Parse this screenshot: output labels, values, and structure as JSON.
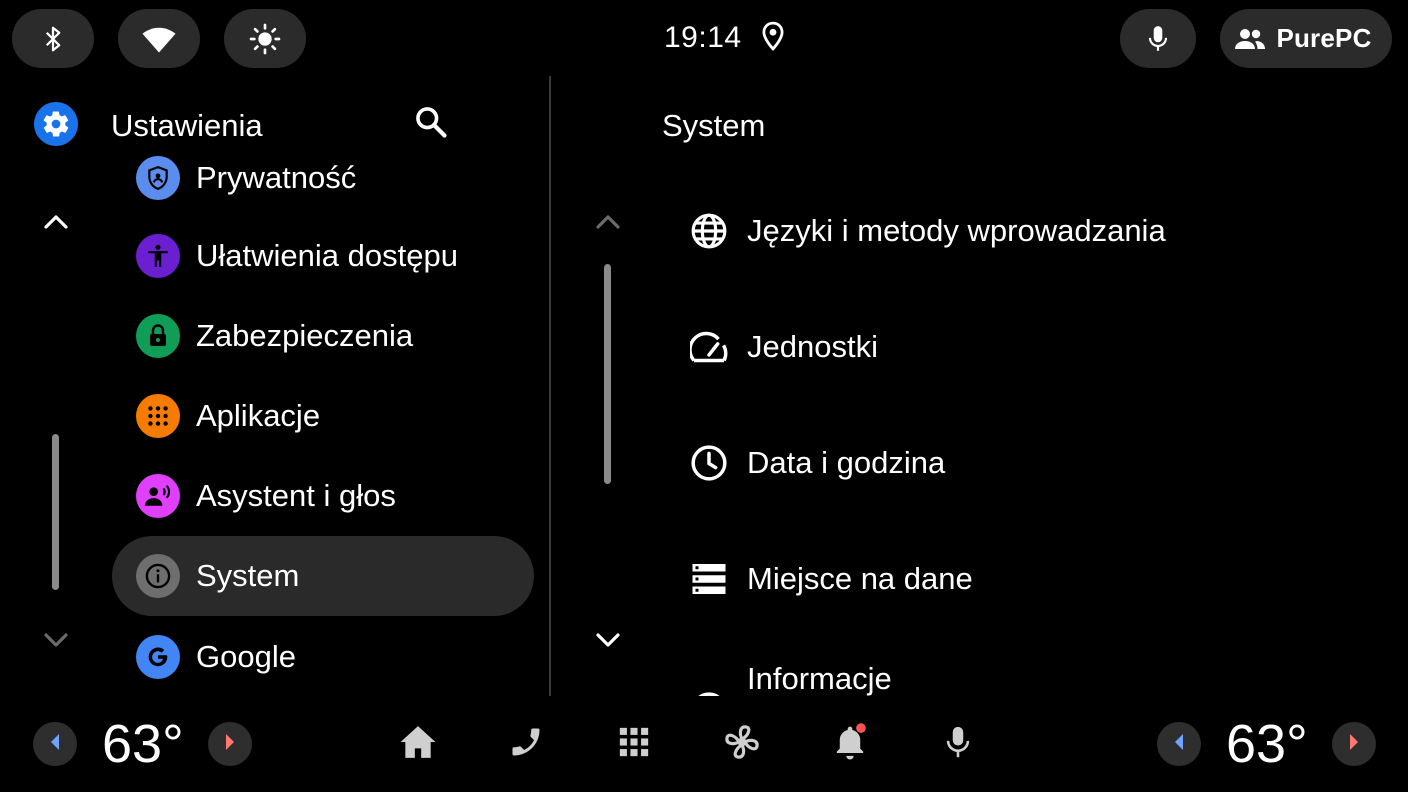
{
  "status_bar": {
    "clock": "19:14",
    "user_label": "PurePC",
    "icons": [
      "bluetooth-icon",
      "wifi-icon",
      "brightness-icon",
      "location-pin-icon",
      "microphone-icon",
      "people-icon"
    ]
  },
  "left_panel": {
    "title": "Ustawienia",
    "items": [
      {
        "label": "Prywatność",
        "icon": "privacy-icon",
        "color": "#5b8def"
      },
      {
        "label": "Ułatwienia dostępu",
        "icon": "accessibility-icon",
        "color": "#6a1fd1"
      },
      {
        "label": "Zabezpieczenia",
        "icon": "lock-icon",
        "color": "#0f9d58"
      },
      {
        "label": "Aplikacje",
        "icon": "apps-icon",
        "color": "#f57c00"
      },
      {
        "label": "Asystent i głos",
        "icon": "assistant-voice-icon",
        "color": "#e040fb"
      },
      {
        "label": "System",
        "icon": "info-icon",
        "color": "#6e6e6e",
        "selected": true
      },
      {
        "label": "Google",
        "icon": "google-icon",
        "color": "#4285f4"
      }
    ]
  },
  "right_panel": {
    "title": "System",
    "items": [
      {
        "label": "Języki i metody wprowadzania",
        "icon": "globe-icon"
      },
      {
        "label": "Jednostki",
        "icon": "speedometer-icon"
      },
      {
        "label": "Data i godzina",
        "icon": "clock-icon"
      },
      {
        "label": "Miejsce na dane",
        "icon": "storage-icon"
      },
      {
        "label": "Informacje",
        "icon": "info-icon"
      }
    ]
  },
  "bottom_bar": {
    "left_temp": "63°",
    "right_temp": "63°",
    "dock_icons": [
      "home-icon",
      "phone-icon",
      "app-grid-icon",
      "fan-icon",
      "notification-bell-icon",
      "microphone-icon"
    ],
    "notification_dot_color": "#ff5252"
  },
  "colors": {
    "accent": "#1a73e8",
    "temp_left_arrow": "#6ea4ff",
    "temp_right_arrow": "#ff7a6e",
    "selected_bg": "#2a2a2a",
    "pill_bg": "#2b2b2b"
  }
}
